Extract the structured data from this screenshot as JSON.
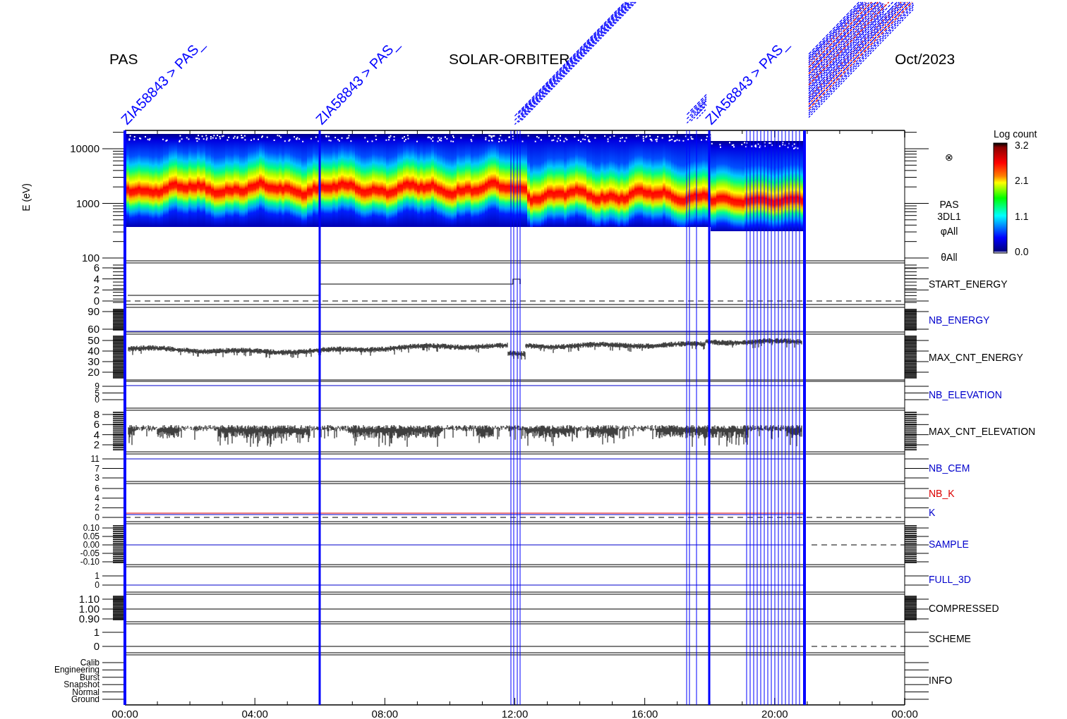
{
  "header": {
    "instrument": "PAS",
    "mission": "SOLAR-ORBITER",
    "date": "Oct/2023"
  },
  "event_labels": [
    "ZIA58843 > PAS_",
    "ZIA58843 > PAS_",
    "ZIA58843 > PAS_"
  ],
  "colorbar": {
    "title": "Log count",
    "ticks": [
      "3.2",
      "2.1",
      "1.1",
      "0.0"
    ]
  },
  "panels": [
    {
      "kind": "spectrogram",
      "ylabel": "E (eV)",
      "yticks": [
        "10000",
        "1000",
        "100"
      ],
      "annotations": [
        "⊗",
        "PAS",
        "3DL1",
        "φAll",
        "θAll"
      ]
    },
    {
      "kind": "steps",
      "yticks": [
        "6",
        "4",
        "2",
        "0"
      ],
      "labels": [
        {
          "text": "START_ENERGY",
          "color": "#000000"
        }
      ]
    },
    {
      "kind": "level",
      "yticks": [
        "90",
        "60"
      ],
      "labels": [
        {
          "text": "NB_ENERGY",
          "color": "#0000cc"
        }
      ]
    },
    {
      "kind": "trace",
      "yticks": [
        "50",
        "40",
        "30",
        "20"
      ],
      "labels": [
        {
          "text": "MAX_CNT_ENERGY",
          "color": "#000000"
        }
      ]
    },
    {
      "kind": "level",
      "yticks": [
        "9",
        "5",
        "0"
      ],
      "labels": [
        {
          "text": "NB_ELEVATION",
          "color": "#0000cc"
        }
      ]
    },
    {
      "kind": "spikes",
      "yticks": [
        "8",
        "6",
        "4",
        "2"
      ],
      "labels": [
        {
          "text": "MAX_CNT_ELEVATION",
          "color": "#000000"
        }
      ]
    },
    {
      "kind": "level",
      "yticks": [
        "11",
        "7",
        "3"
      ],
      "labels": [
        {
          "text": "NB_CEM",
          "color": "#0000cc"
        }
      ]
    },
    {
      "kind": "level",
      "yticks": [
        "6",
        "4",
        "2",
        "0"
      ],
      "labels": [
        {
          "text": "NB_K",
          "color": "#dd0000"
        },
        {
          "text": "K",
          "color": "#0000cc"
        }
      ]
    },
    {
      "kind": "level",
      "yticks": [
        "0.10",
        "0.05",
        "0.00",
        "-0.05",
        "-0.10"
      ],
      "labels": [
        {
          "text": "SAMPLE",
          "color": "#0000cc"
        }
      ]
    },
    {
      "kind": "level",
      "yticks": [
        "1",
        "0"
      ],
      "labels": [
        {
          "text": "FULL_3D",
          "color": "#0000cc"
        }
      ]
    },
    {
      "kind": "level",
      "yticks": [
        "1.10",
        "1.00",
        "0.90"
      ],
      "labels": [
        {
          "text": "COMPRESSED",
          "color": "#000000"
        }
      ]
    },
    {
      "kind": "level",
      "yticks": [
        "1",
        "0"
      ],
      "labels": [
        {
          "text": "SCHEME",
          "color": "#000000"
        }
      ]
    },
    {
      "kind": "modes",
      "yticks": [
        "Calib",
        "Engineering",
        "Burst",
        "Snapshot",
        "Normal",
        "Ground"
      ],
      "labels": [
        {
          "text": "INFO",
          "color": "#000000"
        }
      ]
    }
  ],
  "time_axis": {
    "ticks": [
      "00:00",
      "04:00",
      "08:00",
      "12:00",
      "16:00",
      "20:00",
      "00:00"
    ]
  }
}
